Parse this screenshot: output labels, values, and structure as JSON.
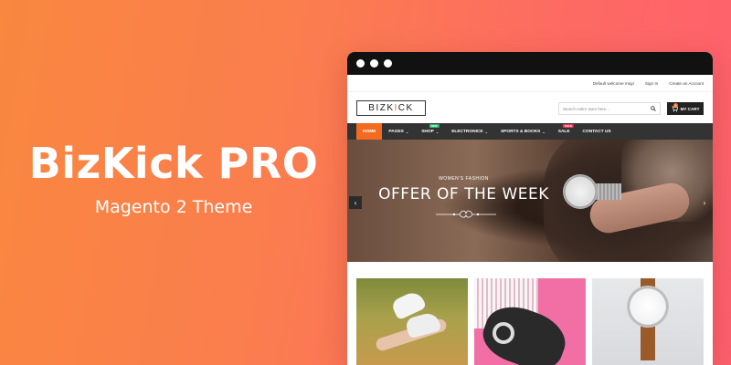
{
  "hero": {
    "title": "BizKick PRO",
    "subtitle": "Magento 2 Theme"
  },
  "store": {
    "topbar": {
      "welcome": "Default welcome msg!",
      "signin": "Sign In",
      "create_account": "Create an Account"
    },
    "logo": {
      "text_left": "BIZK",
      "text_accent": "I",
      "text_right": "CK"
    },
    "search": {
      "placeholder": "Search entire store here..."
    },
    "cart": {
      "label": "MY CART",
      "count": "0"
    },
    "nav": [
      {
        "label": "HOME",
        "active": true,
        "has_dropdown": false,
        "badge": ""
      },
      {
        "label": "PAGES",
        "active": false,
        "has_dropdown": true,
        "badge": ""
      },
      {
        "label": "SHOP",
        "active": false,
        "has_dropdown": true,
        "badge": "NEW"
      },
      {
        "label": "ELECTRONICE",
        "active": false,
        "has_dropdown": true,
        "badge": ""
      },
      {
        "label": "SPORTS & BOOKS",
        "active": false,
        "has_dropdown": true,
        "badge": ""
      },
      {
        "label": "SALE",
        "active": false,
        "has_dropdown": false,
        "badge": "SALE"
      },
      {
        "label": "CONTACT US",
        "active": false,
        "has_dropdown": false,
        "badge": ""
      }
    ],
    "banner": {
      "kicker": "WOMEN'S FASHION",
      "title": "OFFER OF THE WEEK"
    }
  },
  "colors": {
    "accent": "#f26b21",
    "nav_bg": "#333333",
    "bg_gradient_start": "#f9873f",
    "bg_gradient_end": "#fe5f6e"
  }
}
